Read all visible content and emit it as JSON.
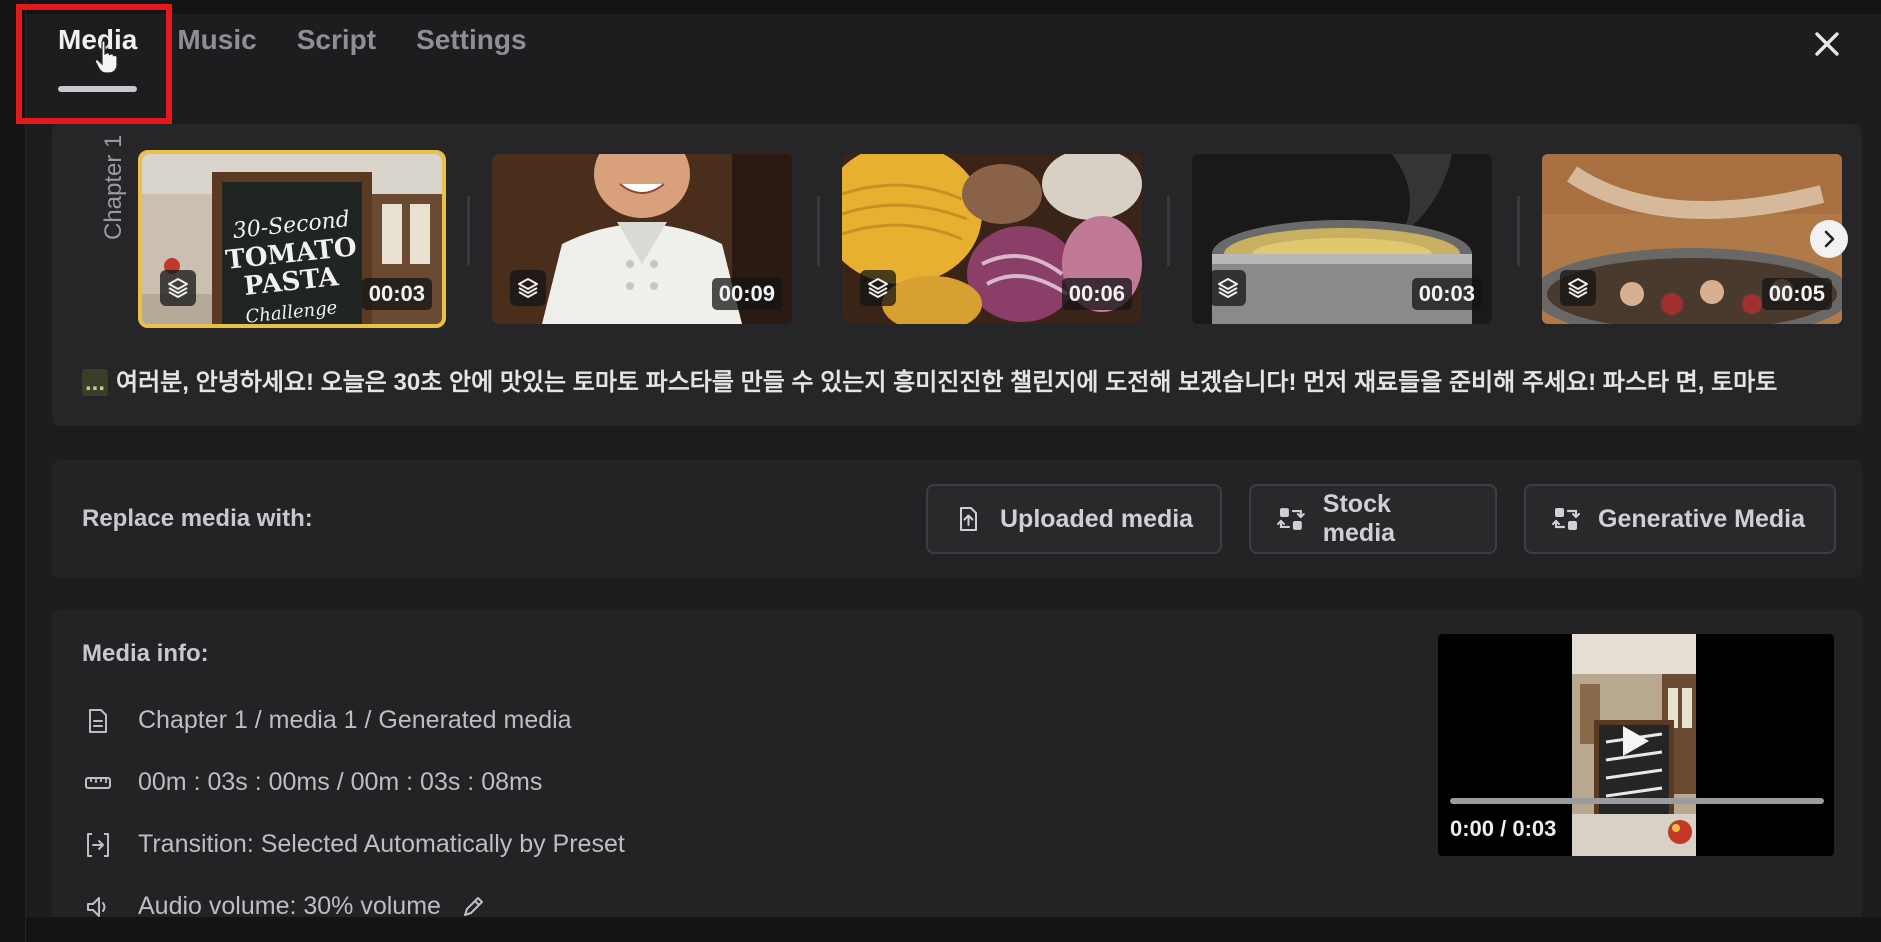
{
  "tabs": [
    {
      "label": "Media",
      "active": true
    },
    {
      "label": "Music",
      "active": false
    },
    {
      "label": "Script",
      "active": false
    },
    {
      "label": "Settings",
      "active": false
    }
  ],
  "close_icon": "close-icon",
  "chapter": {
    "label": "Chapter 1",
    "thumbnails": [
      {
        "duration": "00:03",
        "selected": true,
        "scene": "chalkboard-sign",
        "sign_lines": [
          "30-Second",
          "TOMATO",
          "PASTA",
          "Challenge"
        ]
      },
      {
        "duration": "00:09",
        "selected": false,
        "scene": "chef-portrait"
      },
      {
        "duration": "00:06",
        "selected": false,
        "scene": "pasta-ingredients"
      },
      {
        "duration": "00:03",
        "selected": false,
        "scene": "boiling-pot"
      },
      {
        "duration": "00:05",
        "selected": false,
        "scene": "pan-mushrooms"
      }
    ],
    "script_ellipsis": "...",
    "script_text": "여러분, 안녕하세요! 오늘은 30초 안에 맛있는 토마토 파스타를 만들 수 있는지 흥미진진한 챌린지에 도전해 보겠습니다! 먼저 재료들을 준비해 주세요! 파스타 면, 토마토"
  },
  "replace": {
    "label": "Replace media with:",
    "buttons": [
      {
        "label": "Uploaded media",
        "icon": "upload-file-icon"
      },
      {
        "label": "Stock media",
        "icon": "swap-media-icon"
      },
      {
        "label": "Generative Media",
        "icon": "swap-media-icon"
      }
    ]
  },
  "media_info": {
    "title": "Media info:",
    "path": "Chapter 1 / media 1 / Generated media",
    "timing": "00m : 03s : 00ms / 00m : 03s : 08ms",
    "transition": "Transition: Selected Automatically by Preset",
    "audio": "Audio volume: 30% volume"
  },
  "preview": {
    "time": "0:00 / 0:03",
    "progress": 0.0
  },
  "colors": {
    "accent_selected": "#e8c04a",
    "highlight": "#e21a1a",
    "panel": "#1d1d1f"
  }
}
